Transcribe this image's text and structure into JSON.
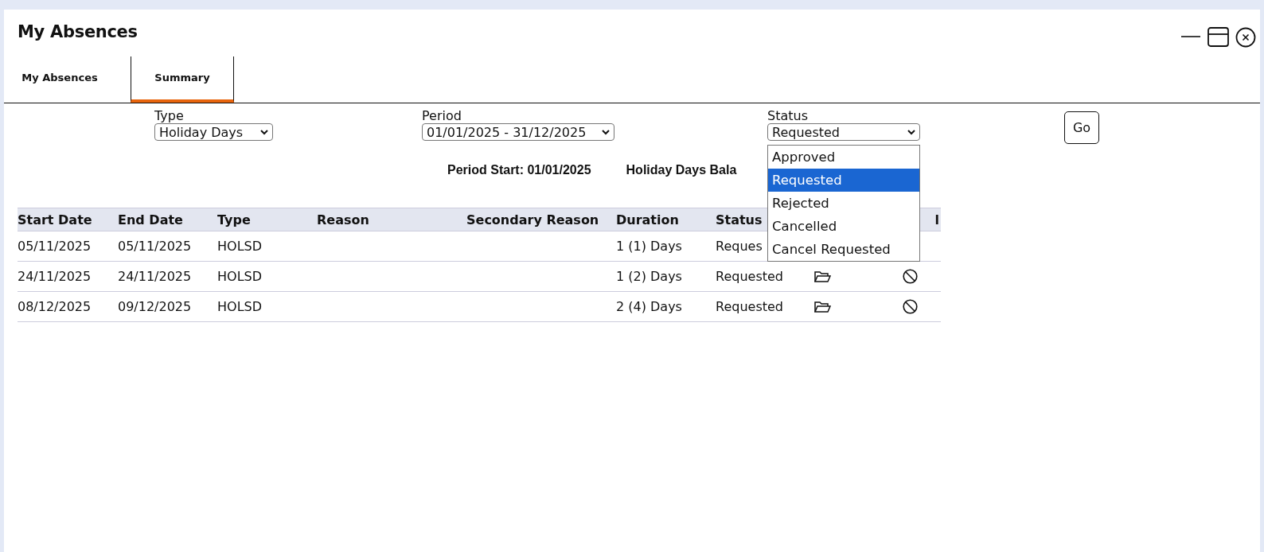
{
  "window": {
    "title": "My Absences"
  },
  "tabs": [
    {
      "label": "My Absences",
      "selected": false
    },
    {
      "label": "Summary",
      "selected": true
    }
  ],
  "filters": {
    "type": {
      "label": "Type",
      "value": "Holiday Days"
    },
    "period": {
      "label": "Period",
      "value": "01/01/2025 - 31/12/2025"
    },
    "status": {
      "label": "Status",
      "value": "Requested",
      "expanded": true,
      "options": [
        {
          "label": "Approved",
          "selected": false
        },
        {
          "label": "Requested",
          "selected": true
        },
        {
          "label": "Rejected",
          "selected": false
        },
        {
          "label": "Cancelled",
          "selected": false
        },
        {
          "label": "Cancel Requested",
          "selected": false
        }
      ]
    },
    "go_button": "Go"
  },
  "summary": {
    "period_start": "Period Start: 01/01/2025",
    "balance": "Holiday Days Bala"
  },
  "table": {
    "columns": [
      "Start Date",
      "End Date",
      "Type",
      "Reason",
      "Secondary Reason",
      "Duration",
      "Status",
      "",
      "l"
    ],
    "rows": [
      {
        "cells": [
          "05/11/2025",
          "05/11/2025",
          "HOLSD",
          "",
          "",
          "1 (1) Days",
          "Reques"
        ]
      },
      {
        "cells": [
          "24/11/2025",
          "24/11/2025",
          "HOLSD",
          "",
          "",
          "1 (2) Days",
          "Requested"
        ],
        "actions": [
          {
            "kind": "folder"
          },
          {
            "kind": "cancel"
          }
        ]
      },
      {
        "cells": [
          "08/12/2025",
          "09/12/2025",
          "HOLSD",
          "",
          "",
          "2 (4) Days",
          "Requested"
        ],
        "actions": [
          {
            "kind": "folder"
          },
          {
            "kind": "cancel"
          }
        ]
      }
    ]
  }
}
